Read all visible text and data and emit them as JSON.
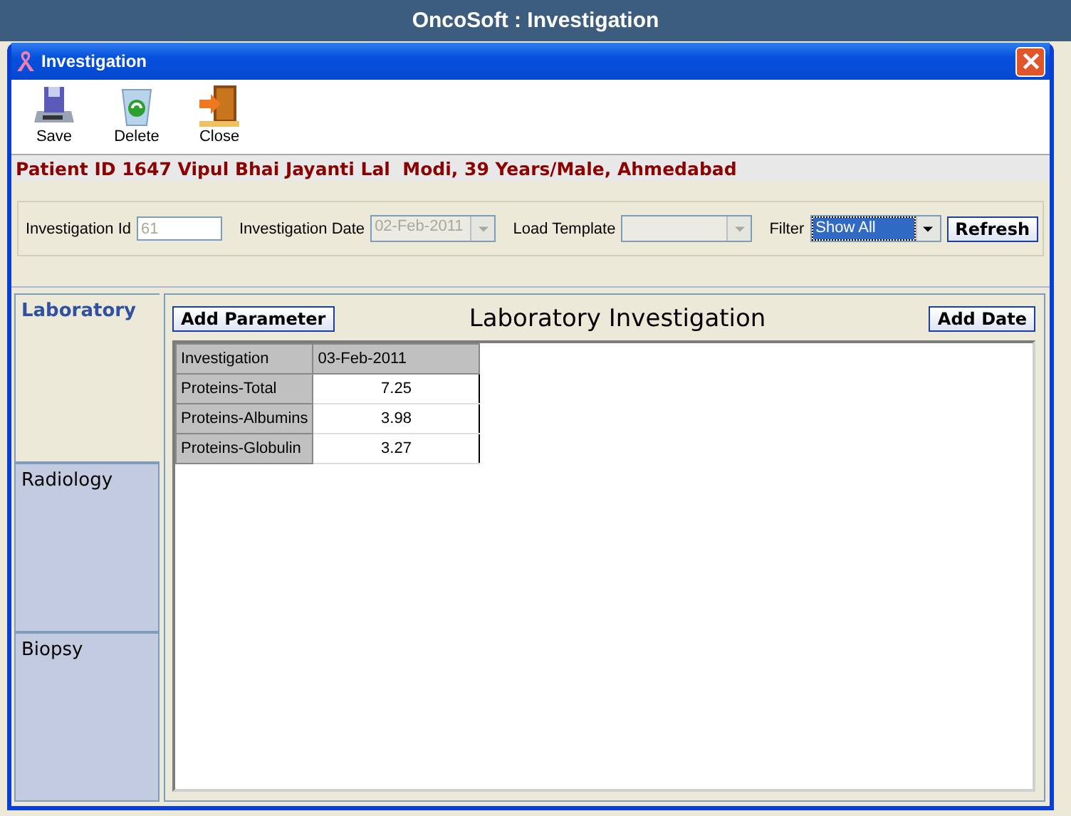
{
  "app_title": "OncoSoft : Investigation",
  "window": {
    "title": "Investigation"
  },
  "toolbar": [
    {
      "label": "Save",
      "kind": "save"
    },
    {
      "label": "Delete",
      "kind": "delete"
    },
    {
      "label": "Close",
      "kind": "close"
    }
  ],
  "patient_banner": "Patient ID 1647 Vipul Bhai Jayanti Lal  Modi, 39 Years/Male, Ahmedabad",
  "form": {
    "investigation_id": {
      "label": "Investigation Id",
      "value": "61",
      "disabled": true
    },
    "investigation_date": {
      "label": "Investigation Date",
      "value": "02-Feb-2011",
      "disabled": true
    },
    "load_template": {
      "label": "Load Template",
      "disabled": true
    },
    "filter": {
      "label": "Filter",
      "value": "Show All",
      "disabled": false
    },
    "refresh_button": "Refresh"
  },
  "tabs": [
    {
      "label": "Laboratory",
      "selected": true
    },
    {
      "label": "Radiology",
      "selected": false
    },
    {
      "label": "Biopsy",
      "selected": false
    }
  ],
  "panel": {
    "add_parameter_button": "Add Parameter",
    "heading": "Laboratory Investigation",
    "add_date_button": "Add Date",
    "table": {
      "columns": [
        "Investigation",
        "03-Feb-2011"
      ],
      "rows": [
        {
          "name": "Proteins-Total",
          "value": "7.25"
        },
        {
          "name": "Proteins-Albumins",
          "value": "3.98"
        },
        {
          "name": "Proteins-Globulin",
          "value": "3.27"
        }
      ]
    }
  }
}
